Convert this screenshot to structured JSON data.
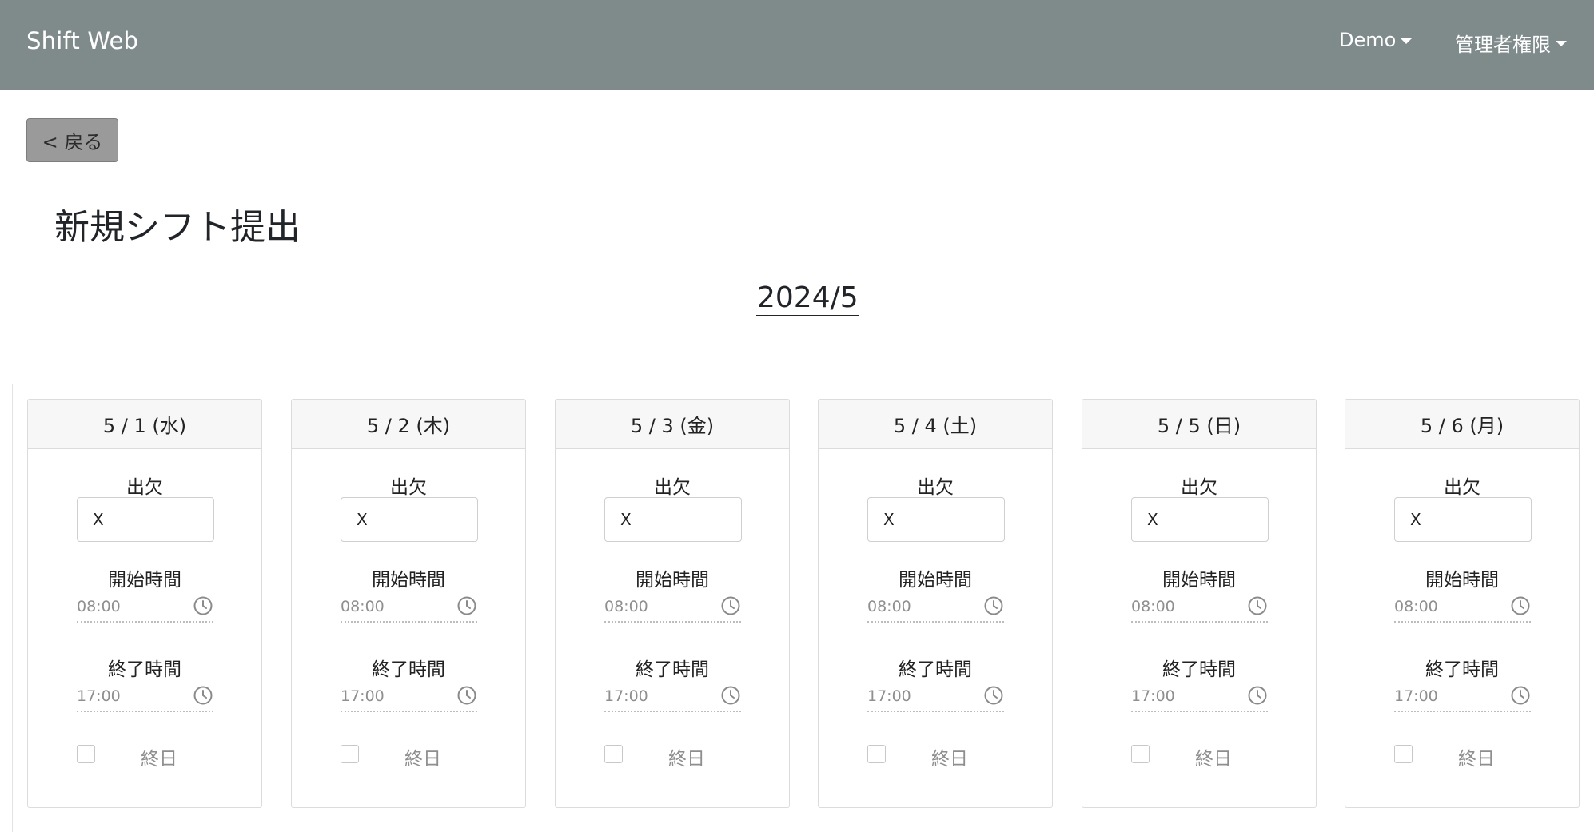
{
  "navbar": {
    "brand": "Shift Web",
    "user_menu": "Demo",
    "role_menu": "管理者権限"
  },
  "back_button": {
    "label": "< 戻る"
  },
  "page_title": "新規シフト提出",
  "month": "2024/5",
  "days": [
    {
      "date": "5 / 1 (水)",
      "attendance_label": "出欠",
      "attendance_value": "X",
      "start_label": "開始時間",
      "start_value": "08:00",
      "end_label": "終了時間",
      "end_value": "17:00",
      "allday_label": "終日",
      "allday_checked": false
    },
    {
      "date": "5 / 2 (木)",
      "attendance_label": "出欠",
      "attendance_value": "X",
      "start_label": "開始時間",
      "start_value": "08:00",
      "end_label": "終了時間",
      "end_value": "17:00",
      "allday_label": "終日",
      "allday_checked": false
    },
    {
      "date": "5 / 3 (金)",
      "attendance_label": "出欠",
      "attendance_value": "X",
      "start_label": "開始時間",
      "start_value": "08:00",
      "end_label": "終了時間",
      "end_value": "17:00",
      "allday_label": "終日",
      "allday_checked": false
    },
    {
      "date": "5 / 4 (土)",
      "attendance_label": "出欠",
      "attendance_value": "X",
      "start_label": "開始時間",
      "start_value": "08:00",
      "end_label": "終了時間",
      "end_value": "17:00",
      "allday_label": "終日",
      "allday_checked": false
    },
    {
      "date": "5 / 5 (日)",
      "attendance_label": "出欠",
      "attendance_value": "X",
      "start_label": "開始時間",
      "start_value": "08:00",
      "end_label": "終了時間",
      "end_value": "17:00",
      "allday_label": "終日",
      "allday_checked": false
    },
    {
      "date": "5 / 6 (月)",
      "attendance_label": "出欠",
      "attendance_value": "X",
      "start_label": "開始時間",
      "start_value": "08:00",
      "end_label": "終了時間",
      "end_value": "17:00",
      "allday_label": "終日",
      "allday_checked": false
    }
  ],
  "icons": {
    "time_picker": "clock-icon",
    "menu_toggle": "caret-down-icon"
  },
  "colors": {
    "navbar": "#7f8b8b",
    "back_button": "#9a9a9a"
  }
}
